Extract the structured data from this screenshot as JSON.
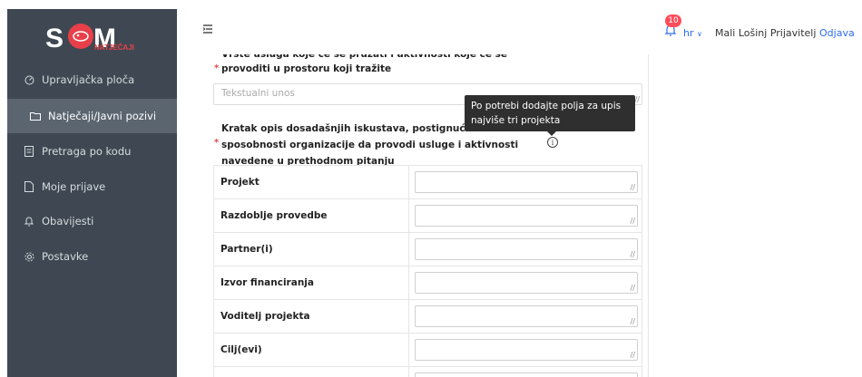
{
  "logo": {
    "letters": "SOM",
    "subtitle": "NATJEČAJI"
  },
  "sidebar": {
    "items": [
      {
        "label": "Upravljačka ploča",
        "icon": "dashboard-icon",
        "active": false
      },
      {
        "label": "Natječaji/Javni pozivi",
        "icon": "folder-icon",
        "active": true
      },
      {
        "label": "Pretraga po kodu",
        "icon": "document-icon",
        "active": false
      },
      {
        "label": "Moje prijave",
        "icon": "file-icon",
        "active": false
      },
      {
        "label": "Obavijesti",
        "icon": "bell-icon",
        "active": false
      },
      {
        "label": "Postavke",
        "icon": "gear-icon",
        "active": false
      }
    ]
  },
  "header": {
    "notification_count": "10",
    "language": "hr",
    "user_name": "Mali Lošinj Prijavitelj",
    "logout_label": "Odjava"
  },
  "form": {
    "question1": "Vrste usluga koje će se pružati i aktivnosti koje će se provoditi u prostoru koji tražite",
    "question1_placeholder": "Tekstualni unos",
    "question2": "Kratak opis dosadašnjih iskustava, postignuća i sposobnosti organizacije da provodi usluge i aktivnosti navedene u prethodnom pitanju",
    "tooltip": "Po potrebi dodajte polja za upis najviše tri projekta",
    "table_rows": [
      "Projekt",
      "Razdoblje provedbe",
      "Partner(i)",
      "Izvor financiranja",
      "Voditelj projekta",
      "Cilj(evi)"
    ]
  },
  "colors": {
    "sidebar_bg": "#3f4852",
    "sidebar_active": "#5b6570",
    "accent": "#2c6df0",
    "required": "#e5484d",
    "badge": "#ff4d5a",
    "logo_red": "#e8404a"
  }
}
